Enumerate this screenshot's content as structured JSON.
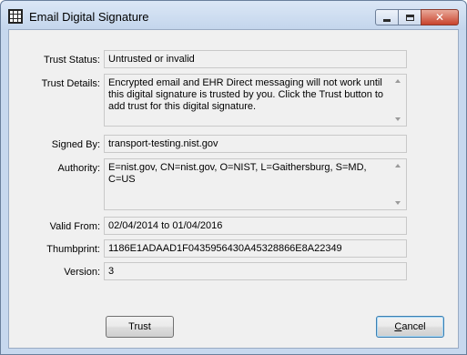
{
  "window": {
    "title": "Email Digital Signature",
    "close_glyph": "✕"
  },
  "fields": {
    "trust_status": {
      "label": "Trust Status:",
      "value": "Untrusted or invalid"
    },
    "trust_details": {
      "label": "Trust Details:",
      "value": "Encrypted email and EHR Direct messaging will not work until this digital signature is trusted by you.  Click the Trust button to add trust for this digital signature."
    },
    "signed_by": {
      "label": "Signed By:",
      "value": "transport-testing.nist.gov"
    },
    "authority": {
      "label": "Authority:",
      "value": "E=nist.gov, CN=nist.gov, O=NIST, L=Gaithersburg, S=MD, C=US"
    },
    "valid_from": {
      "label": "Valid From:",
      "value": "02/04/2014 to 01/04/2016"
    },
    "thumbprint": {
      "label": "Thumbprint:",
      "value": "1186E1ADAAD1F0435956430A45328866E8A22349"
    },
    "version": {
      "label": "Version:",
      "value": "3"
    }
  },
  "buttons": {
    "trust": "Trust",
    "cancel_first": "C",
    "cancel_rest": "ancel"
  },
  "icons": {
    "app": "grid-icon",
    "minimize": "minimize-icon",
    "maximize": "maximize-icon",
    "close": "close-icon",
    "scroll_up": "scroll-up-arrow-icon",
    "scroll_down": "scroll-down-arrow-icon"
  }
}
